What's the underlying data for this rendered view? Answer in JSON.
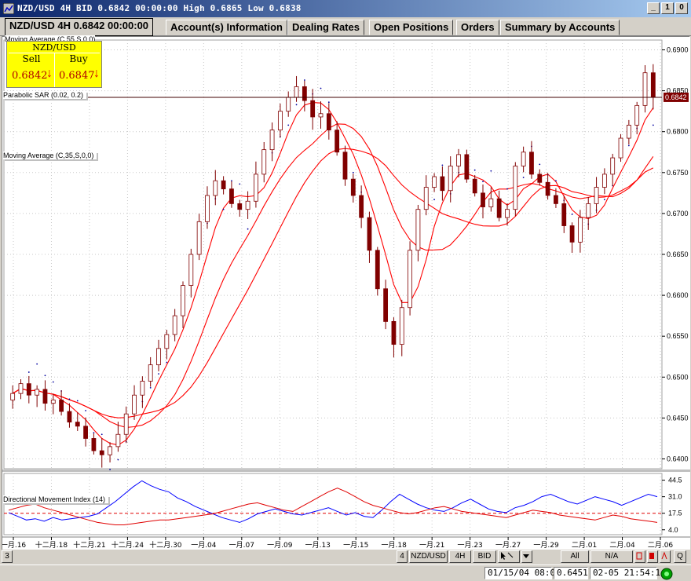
{
  "window": {
    "title": "NZD/USD 4H BID 0.6842 00:00:00 High 0.6865 Low 0.6838",
    "icon": "chart-window-icon",
    "buttons": [
      "_",
      "1",
      "0"
    ]
  },
  "tabs": [
    {
      "label": "NZD/USD 4H 0.6842 00:00:00",
      "active": true
    },
    {
      "label": "Account(s) Information",
      "active": false
    },
    {
      "label": "Dealing Rates",
      "active": false
    },
    {
      "label": "Open Positions",
      "active": false
    },
    {
      "label": "Orders",
      "active": false
    },
    {
      "label": "Summary by Accounts",
      "active": false
    }
  ],
  "quote": {
    "symbol": "NZD/USD",
    "sell_label": "Sell",
    "buy_label": "Buy",
    "sell_price": "0.6842",
    "buy_price": "0.6847",
    "arrow": "↓"
  },
  "indicators": {
    "ma1": "Moving Average (C,55,S,0,0)",
    "sar": "Parabolic SAR (0.02, 0.2)",
    "ma2": "Moving Average (C,35,S,0,0)",
    "dmi": "Directional Movement Index (14)"
  },
  "current_price_tag": "0.6842",
  "chart_data": {
    "type": "candlestick",
    "price_axis": [
      "0.6900",
      "0.6850",
      "0.6800",
      "0.6750",
      "0.6700",
      "0.6650",
      "0.6600",
      "0.6550",
      "0.6500",
      "0.6450",
      "0.6400"
    ],
    "ylim": [
      0.6388,
      0.6912
    ],
    "dmi_axis": [
      "44.5",
      "31.0",
      "17.5",
      "4.0"
    ],
    "dmi_ylim": [
      0,
      50
    ],
    "x_labels": [
      "一月.16",
      "十二月.18",
      "十二月.21",
      "十二月.24",
      "十二月.30",
      "一月.04",
      "一月.07",
      "一月.09",
      "一月.13",
      "一月.15",
      "一月.18",
      "一月.21",
      "一月.23",
      "一月.27",
      "一月.29",
      "二月.01",
      "二月.04",
      "二月.06"
    ],
    "closes": [
      0.648,
      0.6492,
      0.6478,
      0.6485,
      0.6468,
      0.6472,
      0.6458,
      0.6445,
      0.644,
      0.6425,
      0.641,
      0.6405,
      0.6415,
      0.643,
      0.6455,
      0.6478,
      0.6495,
      0.6515,
      0.6535,
      0.6552,
      0.6575,
      0.6612,
      0.665,
      0.669,
      0.6722,
      0.674,
      0.673,
      0.6712,
      0.6705,
      0.6715,
      0.6748,
      0.6778,
      0.6802,
      0.6825,
      0.6842,
      0.6855,
      0.6838,
      0.6818,
      0.6822,
      0.6802,
      0.6775,
      0.6742,
      0.6722,
      0.6695,
      0.6655,
      0.6608,
      0.6568,
      0.654,
      0.6585,
      0.6655,
      0.6705,
      0.6732,
      0.6745,
      0.6728,
      0.6758,
      0.6772,
      0.6742,
      0.6725,
      0.6708,
      0.6718,
      0.6695,
      0.6705,
      0.6758,
      0.6775,
      0.6748,
      0.6738,
      0.6722,
      0.6712,
      0.6685,
      0.6665,
      0.6695,
      0.6712,
      0.6732,
      0.6748,
      0.6768,
      0.6792,
      0.6808,
      0.6832,
      0.6872,
      0.6842
    ],
    "dmi_plus": [
      18,
      15,
      12,
      13,
      11,
      14,
      12,
      13,
      14,
      15,
      17,
      22,
      27,
      33,
      39,
      44,
      40,
      37,
      35,
      30,
      27,
      23,
      20,
      17,
      14,
      12,
      10,
      13,
      17,
      19,
      21,
      19,
      17,
      16,
      18,
      20,
      22,
      19,
      16,
      18,
      15,
      14,
      20,
      27,
      33,
      29,
      25,
      22,
      20,
      19,
      22,
      26,
      29,
      25,
      21,
      19,
      18,
      22,
      24,
      27,
      31,
      33,
      30,
      27,
      25,
      28,
      31,
      29,
      27,
      24,
      27,
      30,
      33,
      31
    ],
    "dmi_minus": [
      20,
      22,
      24,
      25,
      22,
      20,
      18,
      16,
      14,
      12,
      10,
      9,
      8,
      8,
      9,
      10,
      11,
      12,
      12,
      13,
      14,
      15,
      16,
      17,
      19,
      21,
      23,
      25,
      26,
      24,
      22,
      20,
      19,
      23,
      27,
      31,
      35,
      38,
      35,
      31,
      27,
      24,
      22,
      20,
      18,
      17,
      18,
      20,
      22,
      23,
      21,
      19,
      18,
      17,
      16,
      15,
      14,
      16,
      18,
      20,
      19,
      18,
      16,
      15,
      14,
      13,
      12,
      14,
      16,
      15,
      13,
      12,
      11,
      10
    ],
    "adx_level": 17.5
  },
  "bottom_toolbar": {
    "left_tab": "3",
    "buttons": [
      "4",
      "NZD/USD",
      "4H",
      "BID",
      "",
      "",
      "All",
      "",
      "N/A",
      "",
      "",
      "Q"
    ]
  },
  "status": {
    "datetime": "01/15/04 08:00",
    "price": "0.6451",
    "clock": "02-05  21:54:14"
  },
  "colors": {
    "candle": "#800000",
    "ma": "#ff0000",
    "sar": "#0000a0",
    "dmi_plus": "#0000ff",
    "dmi_minus": "#e00000"
  }
}
